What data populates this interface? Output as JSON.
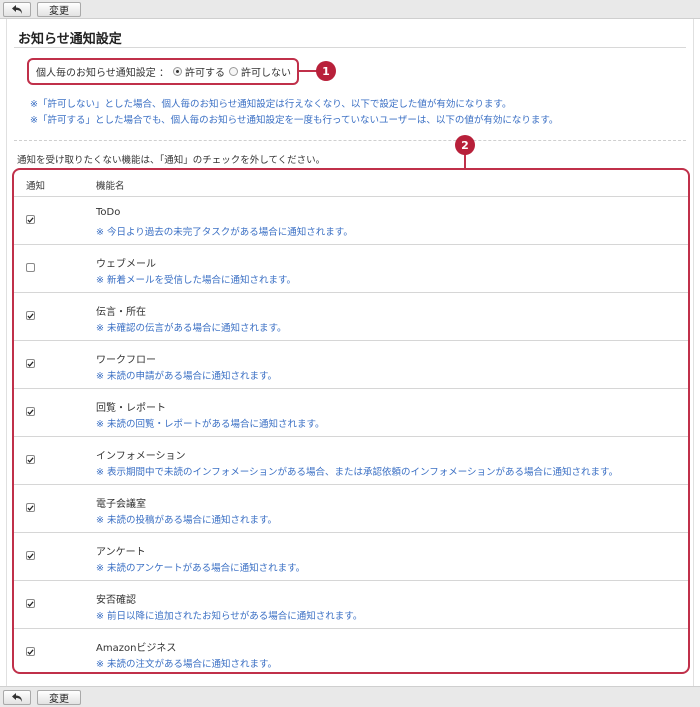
{
  "toolbar": {
    "change_label": "変更"
  },
  "page": {
    "title": "お知らせ通知設定",
    "setting_label": "個人毎のお知らせ通知設定 ：",
    "option_allow": "許可する",
    "option_deny": "許可しない",
    "selected_option": "allow",
    "note1": "※「許可しない」とした場合、個人毎のお知らせ通知設定は行えなくなり、以下で設定した値が有効になります。",
    "note2": "※「許可する」とした場合でも、個人毎のお知らせ通知設定を一度も行っていないユーザーは、以下の値が有効になります。",
    "instruction": "通知を受け取りたくない機能は、「通知」のチェックを外してください。",
    "badge1": "1",
    "badge2": "2",
    "accent_color": "#c0304a"
  },
  "table": {
    "col_notify": "通知",
    "col_feature": "機能名",
    "rows": [
      {
        "name": "ToDo",
        "desc": "※ 今日より過去の未完了タスクがある場合に通知されます。",
        "checked": true
      },
      {
        "name": "ウェブメール",
        "desc": "※ 新着メールを受信した場合に通知されます。",
        "checked": false
      },
      {
        "name": "伝言・所在",
        "desc": "※ 未確認の伝言がある場合に通知されます。",
        "checked": true
      },
      {
        "name": "ワークフロー",
        "desc": "※ 未読の申請がある場合に通知されます。",
        "checked": true
      },
      {
        "name": "回覧・レポート",
        "desc": "※ 未読の回覧・レポートがある場合に通知されます。",
        "checked": true
      },
      {
        "name": "インフォメーション",
        "desc": "※ 表示期間中で未読のインフォメーションがある場合、または承認依頼のインフォメーションがある場合に通知されます。",
        "checked": true
      },
      {
        "name": "電子会議室",
        "desc": "※ 未読の投稿がある場合に通知されます。",
        "checked": true
      },
      {
        "name": "アンケート",
        "desc": "※ 未読のアンケートがある場合に通知されます。",
        "checked": true
      },
      {
        "name": "安否確認",
        "desc": "※ 前日以降に追加されたお知らせがある場合に通知されます。",
        "checked": true
      },
      {
        "name": "Amazonビジネス",
        "desc": "※ 未読の注文がある場合に通知されます。",
        "checked": true
      }
    ]
  }
}
